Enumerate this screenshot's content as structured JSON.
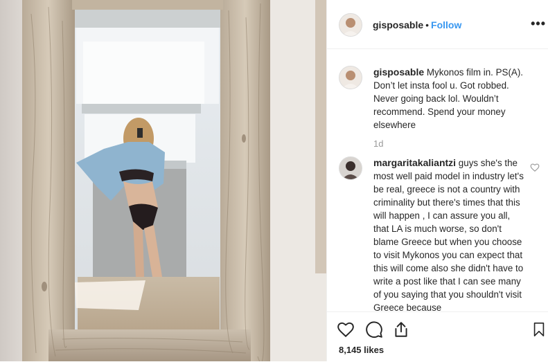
{
  "post": {
    "username": "gisposable",
    "follow_label": "Follow",
    "more_label": "•••",
    "caption": "Mykonos film in. PS(A). Don’t let insta fool u. Got robbed. Never going back lol. Wouldn’t recommend. Spend your money elsewhere",
    "caption_time": "1d"
  },
  "comment1": {
    "username": "margaritakaliantzi",
    "text": "guys she's the most well paid model in industry let's be real, greece is not a country with criminality but there's times that this will happen , I can assure you all, that LA is much worse, so don't blame Greece but when you choose to visit Mykonos you can expect that this will come also she didn't have to write a post like that I can see many of you saying that you shouldn't visit Greece because"
  },
  "actions": {
    "like_icon": "heart-icon",
    "comment_icon": "speech-bubble-icon",
    "share_icon": "share-icon",
    "save_icon": "bookmark-icon",
    "likes_text": "8,145 likes"
  },
  "colors": {
    "link": "#3897f0",
    "muted": "#999999",
    "border": "#efefef"
  }
}
